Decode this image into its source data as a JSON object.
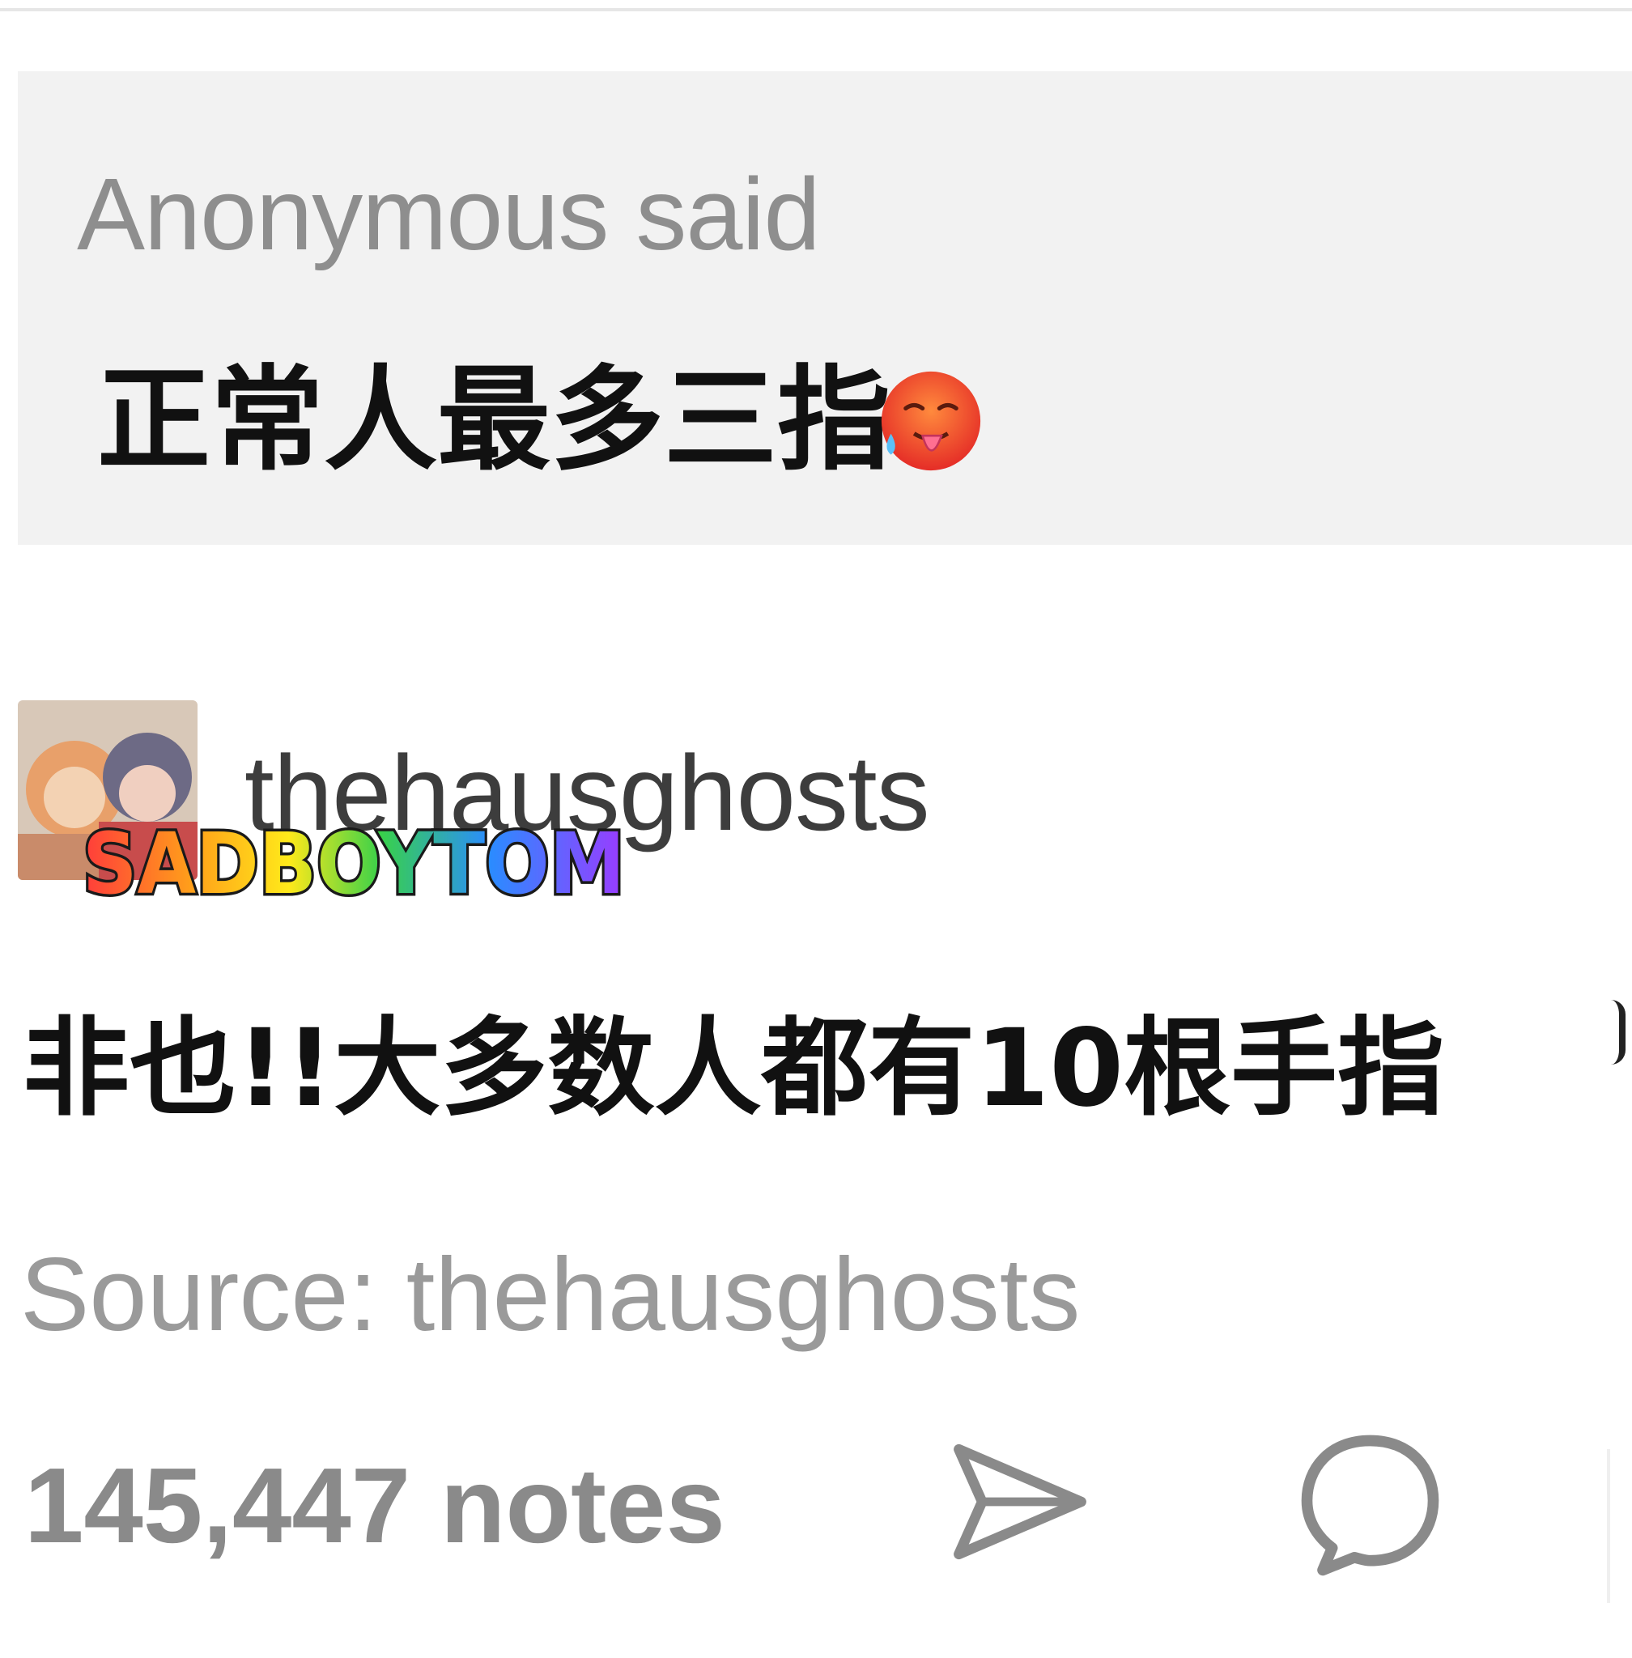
{
  "ask": {
    "asker_label": "Anonymous said",
    "question": "正常人最多三指"
  },
  "answer_post": {
    "username": "thehausghosts",
    "answer": "非也!!大多数人都有10根手指",
    "source": "Source: thehausghosts"
  },
  "watermark": "SADBOYTOM",
  "footer": {
    "notes": "145,447 notes"
  },
  "icons": {
    "emoji": "hot-face-emoji",
    "share": "send-icon",
    "reply": "speech-bubble-icon"
  }
}
